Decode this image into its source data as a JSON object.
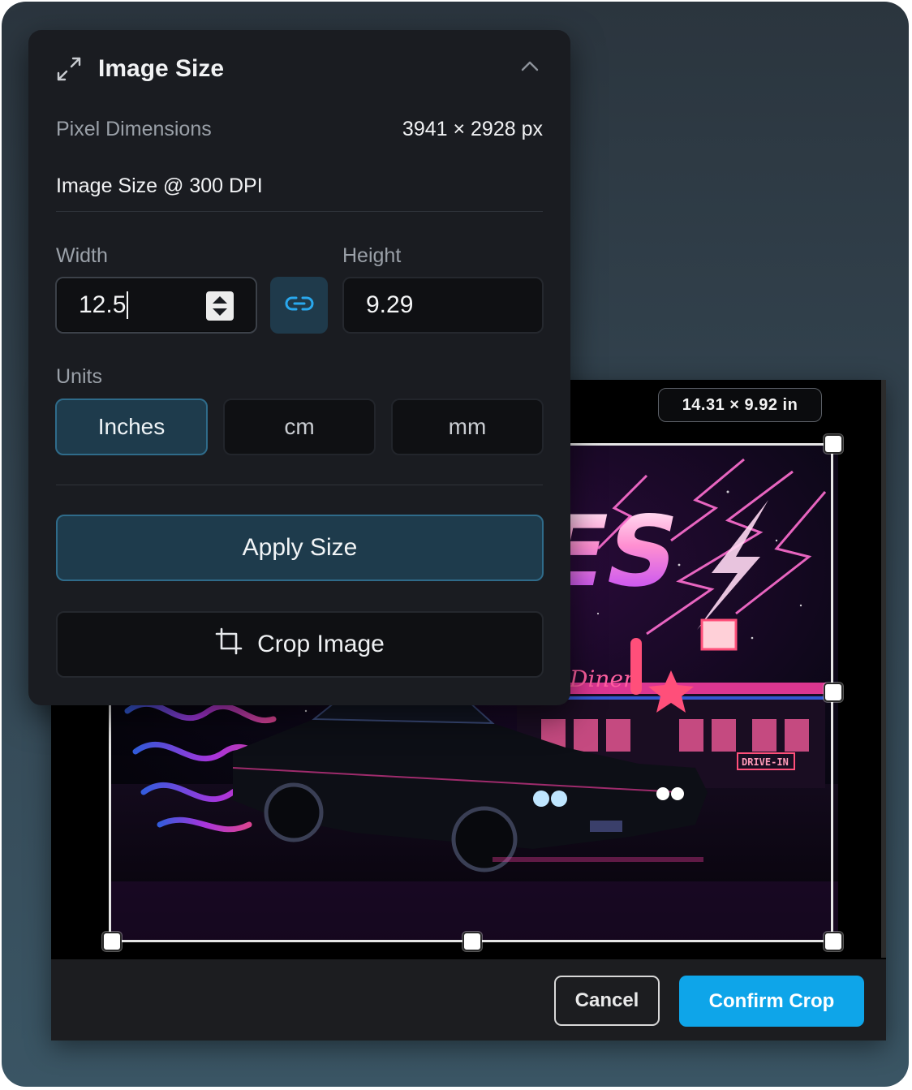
{
  "panel": {
    "title": "Image Size",
    "expand_icon": "expand-arrows-icon",
    "collapse_icon": "chevron-up-icon",
    "pixel_dimensions_label": "Pixel Dimensions",
    "pixel_dimensions_value": "3941 × 2928 px",
    "image_size_label": "Image Size @ 300 DPI",
    "width_label": "Width",
    "width_value": "12.5",
    "height_label": "Height",
    "height_value": "9.29",
    "link_icon": "link-icon",
    "units_label": "Units",
    "units": [
      "Inches",
      "cm",
      "mm"
    ],
    "selected_unit": "Inches",
    "apply_label": "Apply Size",
    "crop_label": "Crop Image",
    "crop_icon": "crop-icon"
  },
  "editor": {
    "dimension_badge": "14.31 × 9.92 in",
    "cancel_label": "Cancel",
    "confirm_label": "Confirm Crop"
  },
  "image": {
    "sign_text": "Diner",
    "drive_in_text": "DRIVE-IN",
    "big_letters": "ES"
  },
  "colors": {
    "accent": "#0ea5e9",
    "panel_bg": "#1a1c21",
    "selected_bg": "#1e3b4c",
    "neon_pink": "#ff3ea5",
    "neon_blue": "#3b6bff"
  }
}
